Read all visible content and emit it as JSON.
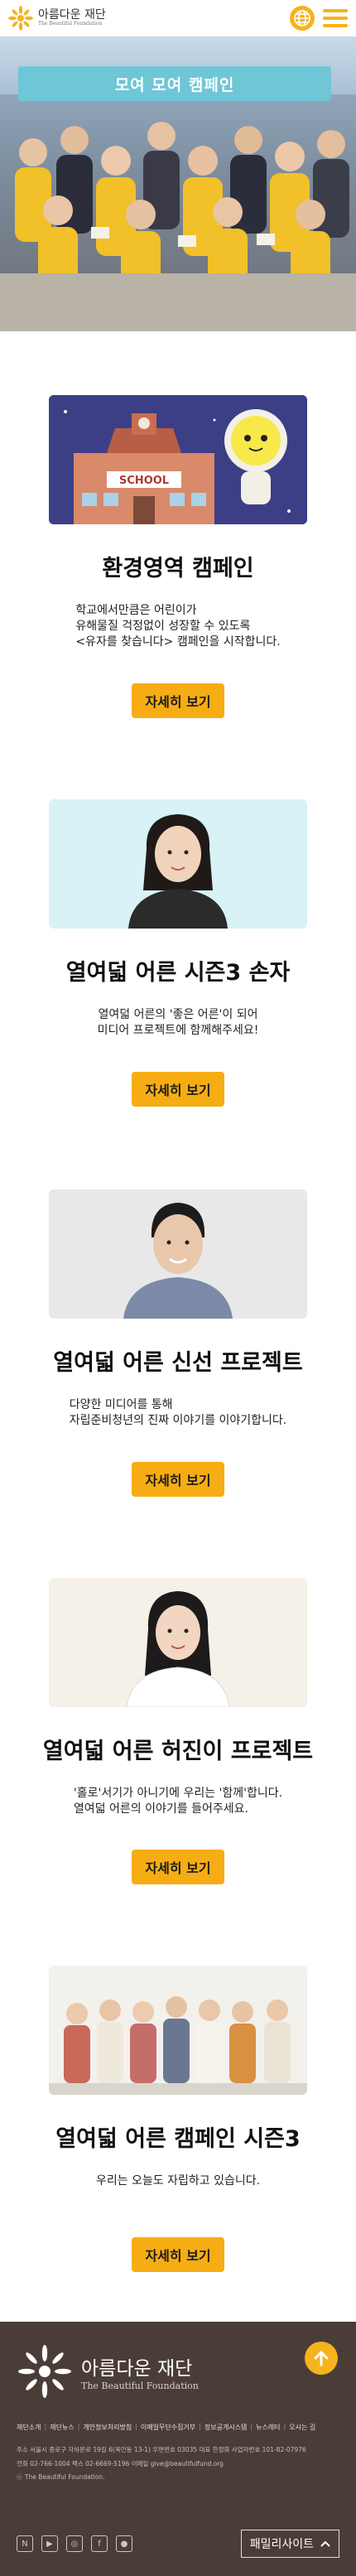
{
  "header": {
    "logo_ko": "아름다운 재단",
    "logo_en": "The Beautiful Foundation",
    "globe_icon": "globe-icon",
    "menu_icon": "hamburger-menu-icon"
  },
  "hero": {
    "banner_text": "모여 모여 캠페인"
  },
  "campaigns": [
    {
      "title": "환경영역 캠페인",
      "desc_lines": [
        "학교에서만큼은 어린이가",
        "유해물질 걱정없이 성장할 수 있도록",
        "<유자를 찾습니다> 캠페인을 시작합니다."
      ],
      "button": "자세히 보기",
      "thumb_text": "SCHOOL"
    },
    {
      "title": "열여덟 어른 시즌3 손자",
      "desc_lines": [
        "열여덟 어른의 '좋은 어른'이 되어",
        "미디어 프로젝트에 함께해주세요!"
      ],
      "button": "자세히 보기"
    },
    {
      "title": "열여덟 어른 신선 프로젝트",
      "desc_lines": [
        "다양한 미디어를 통해",
        "자립준비청년의 진짜 이야기를 이야기합니다."
      ],
      "button": "자세히 보기"
    },
    {
      "title": "열여덟 어른 허진이 프로젝트",
      "desc_lines": [
        "'홀로'서기가 아니기에 우리는 '함께'합니다.",
        "열여덟 어른의 이야기를 들어주세요."
      ],
      "button": "자세히 보기"
    },
    {
      "title": "열여덟 어른 캠페인 시즌3",
      "desc_lines": [
        "우리는 오늘도 자립하고 있습니다."
      ],
      "button": "자세히 보기"
    }
  ],
  "footer": {
    "logo_ko": "아름다운 재단",
    "logo_en": "The Beautiful Foundation",
    "links": [
      "재단소개",
      "재단뉴스",
      "개인정보처리방침",
      "이메일무단수집거부",
      "정보공개시스템",
      "뉴스레터",
      "오시는 길"
    ],
    "address": "주소 서울시 종로구 자하문로 19길 6(옥인동 13-1) 우편번호 03035 대표 한정화 사업자번호 101-82-07976",
    "contact": "전화 02-766-1004 팩스 02-6669-5196 이메일 give@beautifulfund.org",
    "copyright": "ⓒ The Beautiful Foundation.",
    "family_site": "패밀리사이트",
    "sns": [
      "naver-blog-icon",
      "youtube-icon",
      "instagram-icon",
      "facebook-icon",
      "kakao-icon"
    ]
  }
}
